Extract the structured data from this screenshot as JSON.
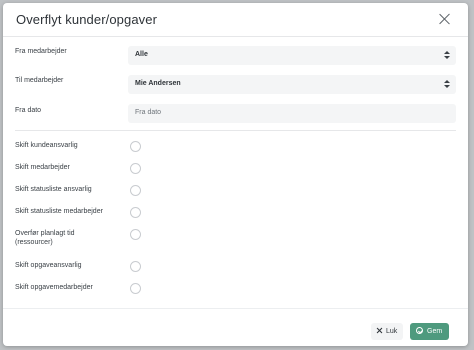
{
  "dialog": {
    "title": "Overflyt kunder/opgaver"
  },
  "fields": {
    "from_employee": {
      "label": "Fra medarbejder",
      "value": "Alle"
    },
    "to_employee": {
      "label": "Til medarbejder",
      "value": "Mie Andersen"
    },
    "from_date": {
      "label": "Fra dato",
      "placeholder": "Fra dato"
    }
  },
  "options": [
    {
      "label": "Skift kundeansvarlig",
      "checked": false
    },
    {
      "label": "Skift medarbejder",
      "checked": false
    },
    {
      "label": "Skift statusliste ansvarlig",
      "checked": false
    },
    {
      "label": "Skift statusliste medarbejder",
      "checked": false
    },
    {
      "label": "Overfør planlagt tid (ressourcer)",
      "checked": false
    },
    {
      "label": "Skift opgaveansvarlig",
      "checked": false
    },
    {
      "label": "Skift opgavemedarbejder",
      "checked": false
    }
  ],
  "footer": {
    "close_label": "Luk",
    "save_label": "Gem"
  },
  "colors": {
    "save_button": "#4e9a7e",
    "overlay": "#bfc2c5"
  }
}
